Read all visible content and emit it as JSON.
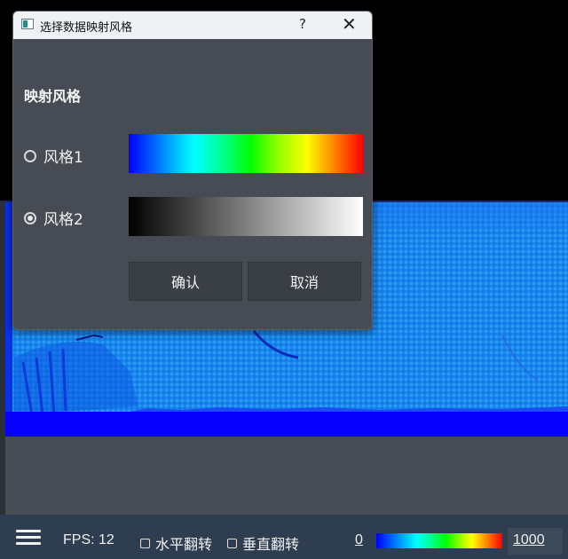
{
  "dialog": {
    "title": "选择数据映射风格",
    "help_label": "?",
    "close_label": "✕",
    "section_title": "映射风格",
    "options": [
      {
        "label": "风格1",
        "checked": false,
        "gradient": "rainbow"
      },
      {
        "label": "风格2",
        "checked": true,
        "gradient": "grayscale"
      }
    ],
    "ok_label": "确认",
    "cancel_label": "取消"
  },
  "statusbar": {
    "fps_text": "FPS: 12",
    "flip_h_label": "水平翻转",
    "flip_v_label": "垂直翻转",
    "flip_h_checked": false,
    "flip_v_checked": false,
    "color_min": "0",
    "color_max": "1000"
  },
  "colors": {
    "heatmap_light": "#1a88f0",
    "heatmap_deep": "#0000ff",
    "dialog_bg": "#474c54",
    "titlebar_bg": "#eef2f4",
    "statusbar_bg": "#2e3e50"
  }
}
